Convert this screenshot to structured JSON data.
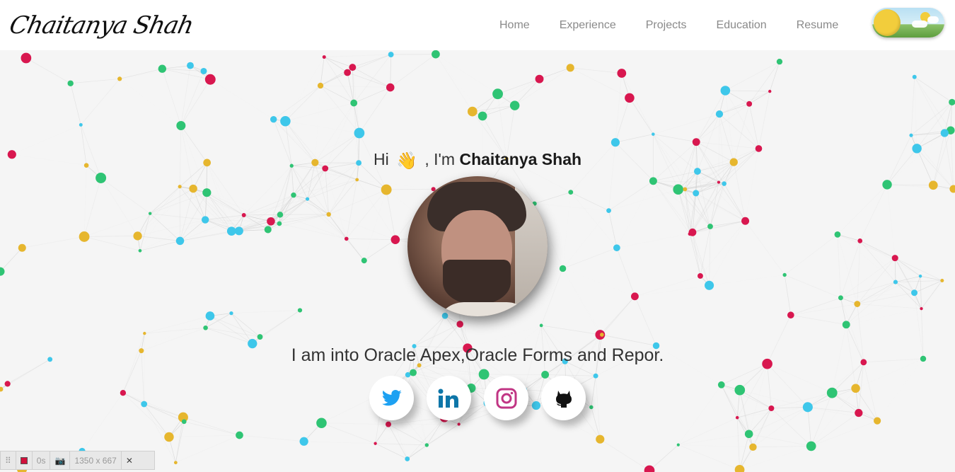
{
  "header": {
    "logo_text": "Chaitanya Shah",
    "nav": [
      "Home",
      "Experience",
      "Projects",
      "Education",
      "Resume"
    ],
    "theme_toggle_state": "light"
  },
  "hero": {
    "greeting_prefix": "Hi",
    "wave_emoji": "👋",
    "greeting_mid": ", I'm",
    "name": "Chaitanya Shah",
    "tagline": "I am into Oracle Apex,Oracle Forms and Repor."
  },
  "socials": [
    {
      "name": "twitter",
      "icon": "twitter-icon",
      "color": "#1da1f2"
    },
    {
      "name": "linkedin",
      "icon": "linkedin-icon",
      "color": "#0e76a8"
    },
    {
      "name": "instagram",
      "icon": "instagram-icon",
      "color": "#c13584"
    },
    {
      "name": "github",
      "icon": "github-icon",
      "color": "#111111"
    }
  ],
  "background": {
    "node_colors": [
      "#d8174f",
      "#2fc474",
      "#3ec7ea",
      "#e6b62e"
    ],
    "link_color": "#cfcfcf"
  },
  "devtools": {
    "timer": "0s",
    "size": "1350 x 667",
    "close": "✕"
  }
}
